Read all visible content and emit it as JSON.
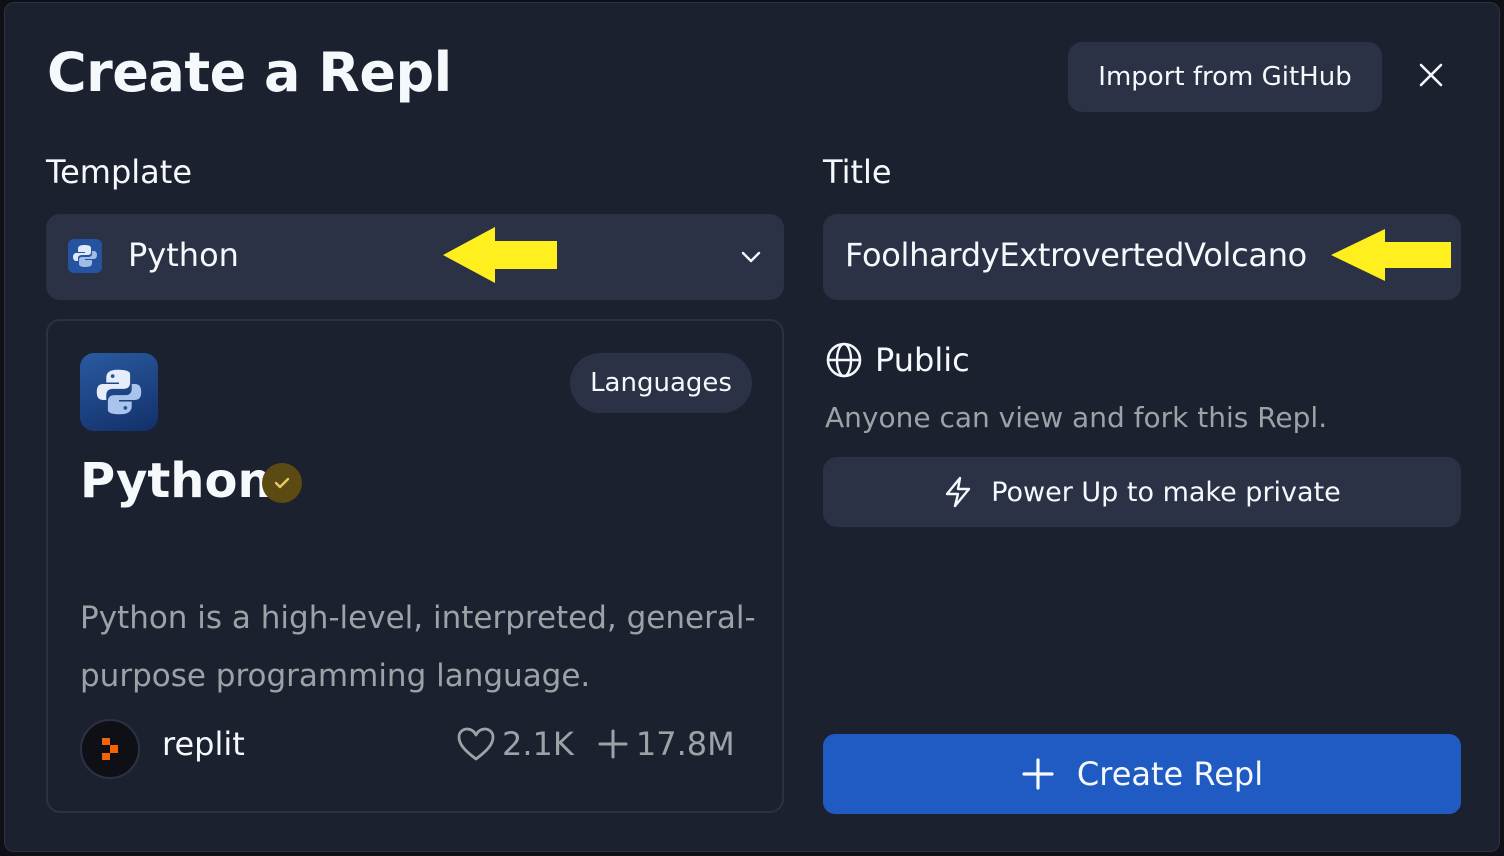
{
  "dialog": {
    "title": "Create a Repl",
    "import_label": "Import from GitHub",
    "close_icon": "close-icon"
  },
  "template": {
    "label": "Template",
    "selected": "Python",
    "icon": "python-icon"
  },
  "title_field": {
    "label": "Title",
    "value": "FoolhardyExtrovertedVolcano"
  },
  "card": {
    "name": "Python",
    "category": "Languages",
    "description": "Python is a high-level, interpreted, general-purpose programming language.",
    "author": "replit",
    "likes": "2.1K",
    "forks": "17.8M",
    "verified": true
  },
  "visibility": {
    "label": "Public",
    "description": "Anyone can view and fork this Repl.",
    "powerup_label": "Power Up to make private"
  },
  "create_label": "Create Repl",
  "colors": {
    "background": "#1c2130",
    "surface": "#2b3245",
    "primary": "#1f5bc2",
    "annotation_arrow": "#ffef1e",
    "verified_badge": "#5b4a12"
  }
}
